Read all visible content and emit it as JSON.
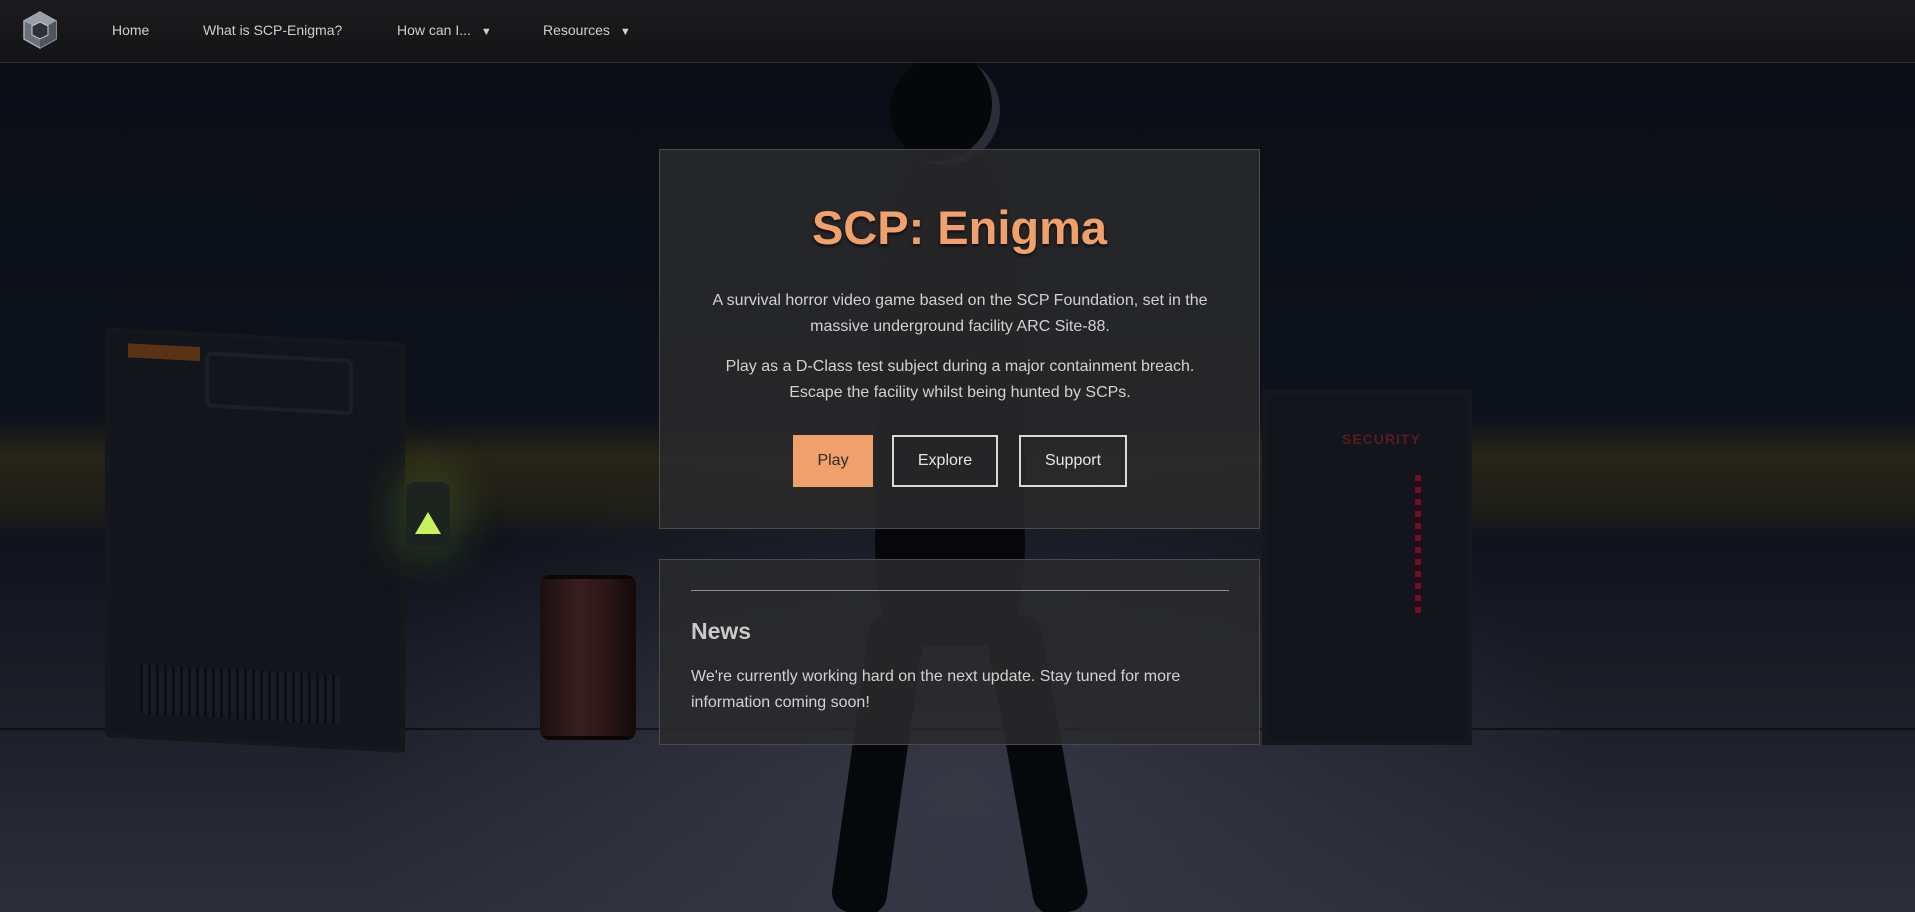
{
  "nav": {
    "items": [
      {
        "label": "Home"
      },
      {
        "label": "What is SCP-Enigma?"
      },
      {
        "label": "How can I..."
      },
      {
        "label": "Resources"
      }
    ],
    "caret": "▼"
  },
  "scene": {
    "door_sign": "SECURITY"
  },
  "hero": {
    "title": "SCP: Enigma",
    "paragraph1": "A survival horror video game based on the SCP Foundation, set in the massive underground facility ARC Site-88.",
    "paragraph2": "Play as a D-Class test subject during a major containment breach. Escape the facility whilst being hunted by SCPs.",
    "buttons": {
      "play": "Play",
      "explore": "Explore",
      "support": "Support"
    }
  },
  "news": {
    "heading": "News",
    "body": "We're currently working hard on the next update. Stay tuned for more information coming soon!"
  },
  "colors": {
    "accent": "#f0a06a",
    "nav_bg": "#1a1a1c",
    "card_bg": "#2a2a2c"
  },
  "icons": {
    "logo": "cube-logo-icon",
    "dropdown": "chevron-down-icon"
  }
}
